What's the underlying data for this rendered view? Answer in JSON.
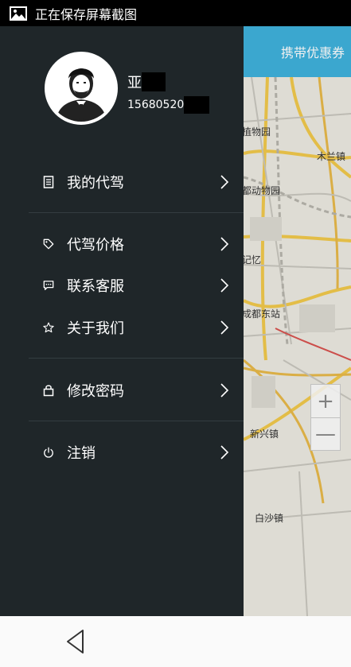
{
  "status_bar": {
    "icon": "image-icon",
    "text": "正在保存屏幕截图"
  },
  "map": {
    "header_button": "携带优惠券",
    "labels": [
      {
        "key": "a",
        "text": "植物园"
      },
      {
        "key": "b",
        "text": "木兰镇"
      },
      {
        "key": "c",
        "text": "都动物园"
      },
      {
        "key": "d",
        "text": "记忆"
      },
      {
        "key": "e",
        "text": "成都东站"
      },
      {
        "key": "f",
        "text": "新兴镇"
      },
      {
        "key": "g",
        "text": "白沙镇"
      }
    ],
    "zoom_in": "+",
    "zoom_out": "—"
  },
  "profile": {
    "name": "亚",
    "phone": "15680520"
  },
  "menu": [
    {
      "label": "我的代驾",
      "icon": "document-icon"
    },
    {
      "label": "代驾价格",
      "icon": "tag-icon"
    },
    {
      "label": "联系客服",
      "icon": "chat-icon"
    },
    {
      "label": "关于我们",
      "icon": "star-icon"
    },
    {
      "label": "修改密码",
      "icon": "lock-icon"
    },
    {
      "label": "注销",
      "icon": "power-icon"
    }
  ],
  "nav": {
    "back": "back-icon"
  },
  "colors": {
    "drawer_bg": "#1f2629",
    "accent": "#3fb2dc",
    "divider": "#343d41"
  }
}
